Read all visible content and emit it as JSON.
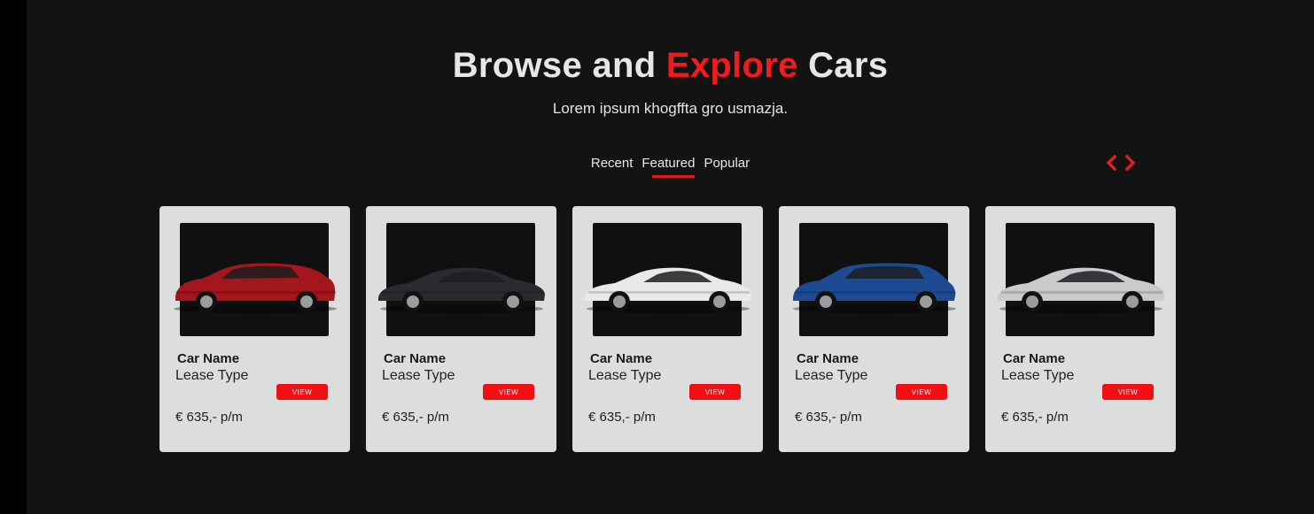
{
  "heading": {
    "part1": "Browse and ",
    "accent": "Explore",
    "part2": " Cars"
  },
  "subtitle": "Lorem ipsum khogffta gro usmazja.",
  "tabs": [
    {
      "label": "Recent",
      "active": false
    },
    {
      "label": "Featured",
      "active": true
    },
    {
      "label": "Popular",
      "active": false
    }
  ],
  "nav_icons": {
    "prev": "chevron-left-icon",
    "next": "chevron-right-icon"
  },
  "colors": {
    "accent": "#ee1c1c",
    "background": "#131314",
    "card": "#dcdedd"
  },
  "cards": [
    {
      "name": "Car Name",
      "lease": "Lease Type",
      "button": "VIEW",
      "price": "€ 635,- p/m",
      "car_color": "#a3161c",
      "body": "suv"
    },
    {
      "name": "Car Name",
      "lease": "Lease Type",
      "button": "VIEW",
      "price": "€ 635,- p/m",
      "car_color": "#2a2b2e",
      "body": "sedan"
    },
    {
      "name": "Car Name",
      "lease": "Lease Type",
      "button": "VIEW",
      "price": "€ 635,- p/m",
      "car_color": "#e9e9ea",
      "body": "sedan"
    },
    {
      "name": "Car Name",
      "lease": "Lease Type",
      "button": "VIEW",
      "price": "€ 635,- p/m",
      "car_color": "#1e4a93",
      "body": "hatch"
    },
    {
      "name": "Car Name",
      "lease": "Lease Type",
      "button": "VIEW",
      "price": "€ 635,- p/m",
      "car_color": "#c9cbcd",
      "body": "sedan"
    }
  ]
}
